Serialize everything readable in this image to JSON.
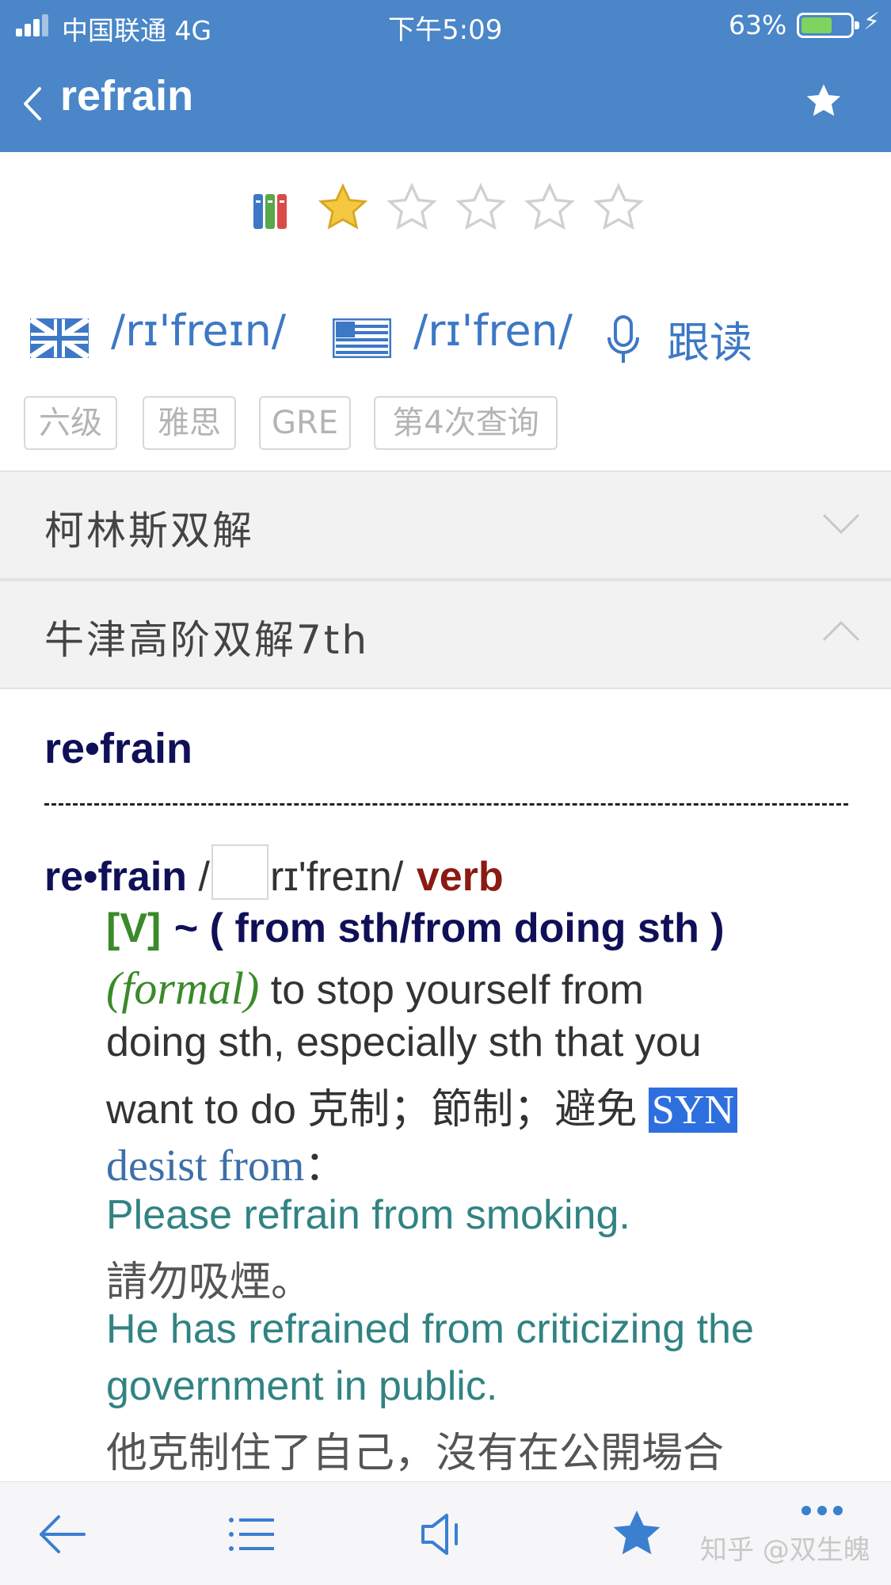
{
  "status_bar": {
    "carrier": "中国联通  4G",
    "time": "下午5:09",
    "battery_percent": "63%",
    "battery_level": 0.63,
    "colors": {
      "bar": "#4a86c8",
      "battery_fill": "#7ed45f"
    }
  },
  "nav": {
    "back_icon": "chevron-left-icon",
    "title": "refrain",
    "favorite_icon": "star-icon"
  },
  "rating": {
    "books_icon": "books-icon",
    "stars_total": 5,
    "stars_filled": 1,
    "colors": {
      "filled": "#f5c842",
      "empty": "#d8d8d8"
    }
  },
  "pronunciation": {
    "uk": {
      "flag_icon": "uk-flag-icon",
      "ipa": "/rɪ'freɪn/"
    },
    "us": {
      "flag_icon": "us-flag-icon",
      "ipa": "/rɪ'fren/"
    },
    "mic_icon": "microphone-icon",
    "follow_label": "跟读",
    "color": "#3d78c6"
  },
  "tags": [
    "六级",
    "雅思",
    "GRE",
    "第4次查询"
  ],
  "sections": [
    {
      "label": "柯林斯双解",
      "expanded": false
    },
    {
      "label": "牛津高阶双解7th",
      "expanded": true
    }
  ],
  "entry": {
    "headword": "re•frain",
    "head_line": {
      "word": "re•frain",
      "slash_open": " /",
      "ipa": "rɪ'freɪn/",
      "pos": "verb"
    },
    "pattern": {
      "code": "[V]",
      "form": "~ ( from sth/from doing sth )"
    },
    "register": "(formal)",
    "definition_1": " to stop yourself from",
    "definition_2": "doing sth, especially sth that you",
    "definition_3": "want to do 克制；節制；避免 ",
    "syn_label": "SYN",
    "synonym": " desist from",
    "synonym_colon": "：",
    "examples": [
      {
        "en": "Please refrain from smoking.",
        "zh": "請勿吸煙。"
      },
      {
        "en_1": "He has refrained from criticizing the",
        "en_2": "government in public.",
        "zh": "他克制住了自己，沒有在公開場合"
      }
    ]
  },
  "toolbar": {
    "icons": [
      "arrow-left-icon",
      "list-icon",
      "speaker-icon",
      "star-icon",
      "more-icon"
    ],
    "watermark": "知乎 @双生魄"
  }
}
